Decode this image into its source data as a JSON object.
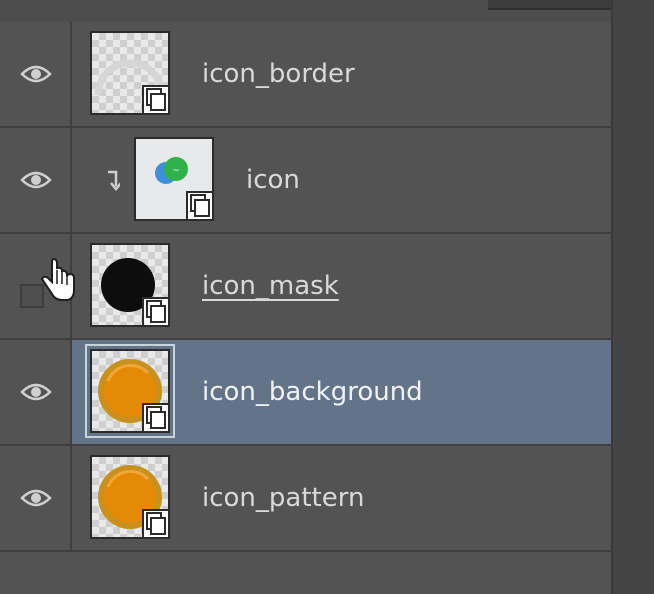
{
  "panel": "layers",
  "layers": [
    {
      "name": "icon_border",
      "visible": true,
      "clipped": false,
      "selected": false,
      "thumbnail": "ring-outline",
      "underlined": false
    },
    {
      "name": "icon",
      "visible": true,
      "clipped": true,
      "selected": false,
      "thumbnail": "green-blue-logo",
      "underlined": false
    },
    {
      "name": "icon_mask",
      "visible": false,
      "clipped": false,
      "selected": false,
      "thumbnail": "black-circle",
      "underlined": true
    },
    {
      "name": "icon_background",
      "visible": true,
      "clipped": false,
      "selected": true,
      "thumbnail": "orange-circle",
      "underlined": false
    },
    {
      "name": "icon_pattern",
      "visible": true,
      "clipped": false,
      "selected": false,
      "thumbnail": "orange-circle",
      "underlined": false
    }
  ],
  "icons": {
    "visibility": "eye-icon",
    "clip": "clipping-mask-arrow-icon",
    "smart_object": "smart-object-badge-icon",
    "cursor": "hand-pointer-icon"
  },
  "colors": {
    "panel_bg": "#535353",
    "selected_row": "#647488",
    "divider": "#3f3f3f",
    "text": "#d9d9d9"
  }
}
